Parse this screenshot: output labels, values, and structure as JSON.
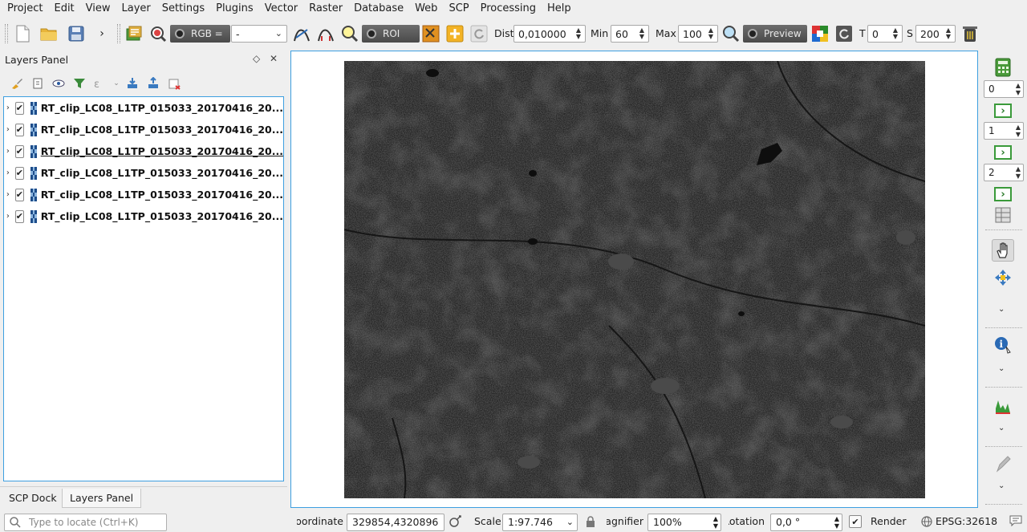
{
  "menu": {
    "items": [
      "Project",
      "Edit",
      "View",
      "Layer",
      "Settings",
      "Plugins",
      "Vector",
      "Raster",
      "Database",
      "Web",
      "SCP",
      "Processing",
      "Help"
    ]
  },
  "toolbar": {
    "rgb_label": "RGB =",
    "rgb_value": "-",
    "roi_label": "ROI",
    "dist_label": "Dist",
    "dist_value": "0,010000",
    "min_label": "Min",
    "min_value": "60",
    "max_label": "Max",
    "max_value": "100",
    "preview_label": "Preview",
    "t_label": "T",
    "t_value": "0",
    "s_label": "S",
    "s_value": "200"
  },
  "layers_panel": {
    "title": "Layers Panel",
    "layers": [
      {
        "name": "RT_clip_LC08_L1TP_015033_20170416_20...",
        "checked": true
      },
      {
        "name": "RT_clip_LC08_L1TP_015033_20170416_20...",
        "checked": true
      },
      {
        "name": "RT_clip_LC08_L1TP_015033_20170416_20...",
        "checked": true
      },
      {
        "name": "RT_clip_LC08_L1TP_015033_20170416_20...",
        "checked": true
      },
      {
        "name": "RT_clip_LC08_L1TP_015033_20170416_20...",
        "checked": true
      },
      {
        "name": "RT_clip_LC08_L1TP_015033_20170416_20...",
        "checked": true
      }
    ]
  },
  "dock_tabs": {
    "scp_dock": "SCP Dock",
    "layers_panel": "Layers Panel"
  },
  "locator": {
    "placeholder": "Type to locate (Ctrl+K)"
  },
  "right_bar": {
    "spin_1": "0",
    "spin_2": "1",
    "spin_3": "2"
  },
  "status": {
    "coordinate_label": "Coordinate",
    "coordinate_value": "329854,4320896",
    "scale_label": "Scale",
    "scale_value": "1:97.746",
    "magnifier_label": "Magnifier",
    "magnifier_value": "100%",
    "rotation_label": "Rotation",
    "rotation_value": "0,0 °",
    "render_label": "Render",
    "crs_label": "EPSG:32618"
  }
}
